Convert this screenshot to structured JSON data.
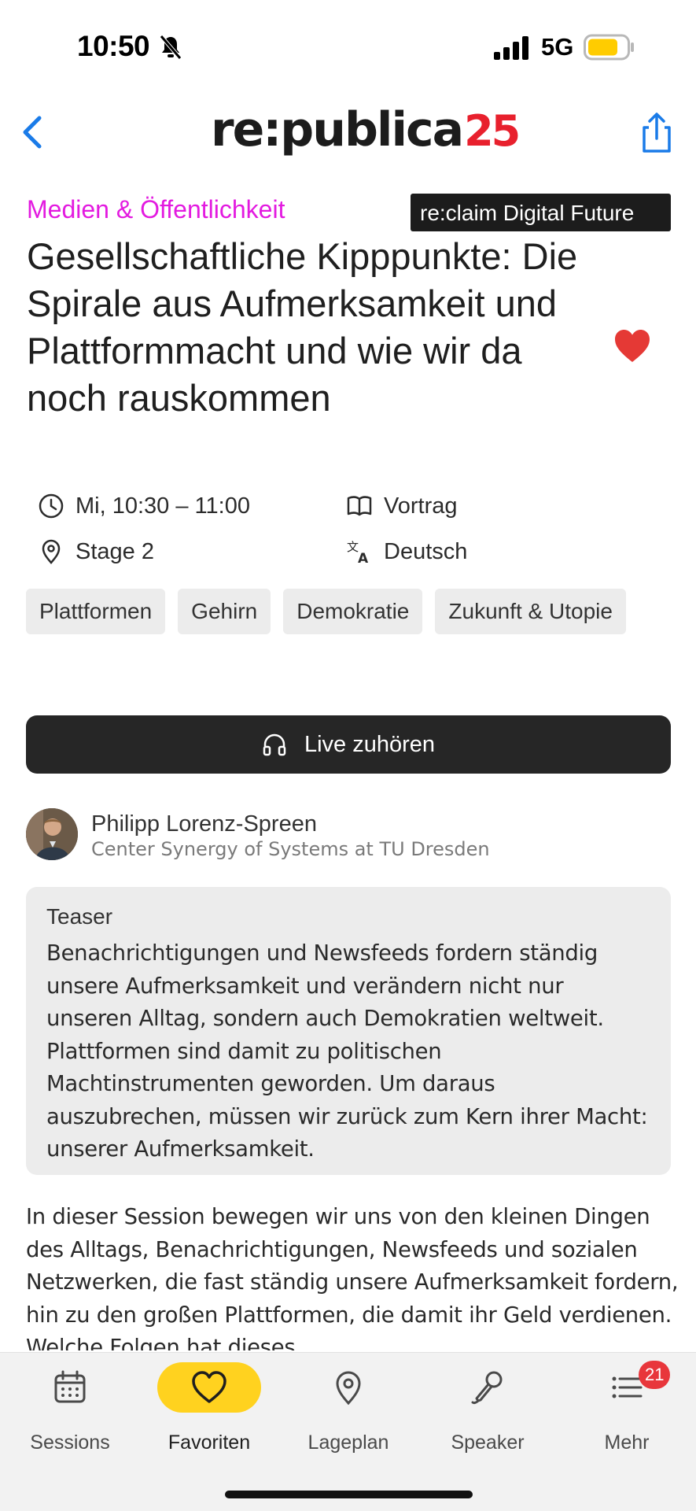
{
  "status_bar": {
    "time": "10:50",
    "network": "5G"
  },
  "header": {
    "logo_text": "re:publica",
    "logo_year": "25"
  },
  "session": {
    "category": "Medien & Öffentlichkeit",
    "track": "re:claim Digital Future",
    "title": "Gesellschaftliche Kipppunkte: Die Spirale aus Aufmerksamkeit und Plattformmacht und wie wir da noch rauskommen",
    "time": "Mi, 10:30 – 11:00",
    "format": "Vortrag",
    "stage": "Stage 2",
    "language": "Deutsch",
    "tags": [
      "Plattformen",
      "Gehirn",
      "Demokratie",
      "Zukunft & Utopie"
    ],
    "listen_label": "Live zuhören",
    "speaker": {
      "name": "Philipp Lorenz-Spreen",
      "organization": "Center Synergy of Systems at TU Dresden"
    },
    "teaser_label": "Teaser",
    "teaser_text": "Benachrichtigungen und Newsfeeds fordern ständig unsere Aufmerksamkeit und verändern nicht nur unseren Alltag, sondern auch Demokratien weltweit. Plattformen sind damit zu politischen Machtinstrumenten geworden. Um daraus auszubrechen, müssen wir zurück zum Kern ihrer Macht: unserer Aufmerksamkeit.",
    "description": "In dieser Session bewegen wir uns von den kleinen Dingen des Alltags, Benachrichtigungen, Newsfeeds und sozialen Netzwerken, die fast ständig unsere Aufmerksamkeit fordern, hin zu den großen Plattformen, die damit ihr Geld verdienen. Welche Folgen hat dieses"
  },
  "tab_bar": {
    "tabs": [
      {
        "label": "Sessions",
        "icon": "calendar-icon"
      },
      {
        "label": "Favoriten",
        "icon": "heart-icon",
        "active": true
      },
      {
        "label": "Lageplan",
        "icon": "map-pin-icon"
      },
      {
        "label": "Speaker",
        "icon": "microphone-icon"
      },
      {
        "label": "Mehr",
        "icon": "list-icon",
        "badge": "21"
      }
    ]
  },
  "colors": {
    "category": "#e31ae0",
    "accent": "#ffd21f",
    "heart": "#e53935",
    "link": "#1a7be8",
    "badge": "#e8363b"
  }
}
